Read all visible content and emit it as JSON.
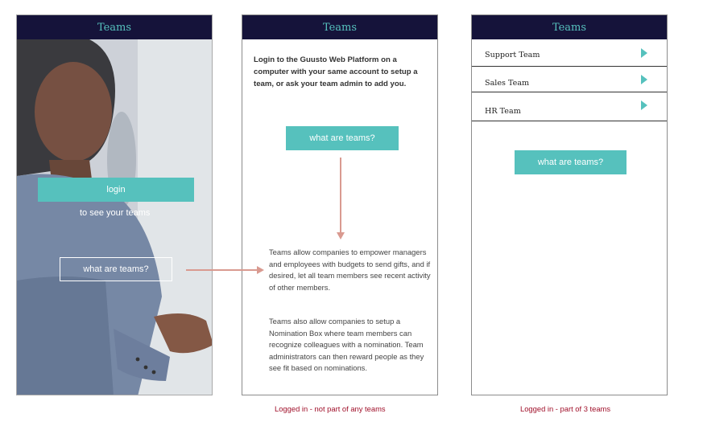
{
  "screens": {
    "logged_out": {
      "title": "Teams",
      "login_label": "login",
      "subtext": "to see your teams",
      "what_are_teams_label": "what are teams?"
    },
    "no_teams": {
      "title": "Teams",
      "message": "Login to the Guusto Web Platform on a computer with your same account to setup a team, or ask your team admin to add you.",
      "what_are_teams_label": "what are teams?",
      "explanation_1": "Teams allow companies to empower managers and employees with budgets to send gifts, and if desired, let all team members see recent activity of other members.",
      "explanation_2": "Teams also allow companies to setup a Nomination Box where team members can recognize colleagues with a nomination. Team administrators can then reward people as they see fit based on nominations."
    },
    "with_teams": {
      "title": "Teams",
      "teams": [
        {
          "label": "Support Team"
        },
        {
          "label": "Sales Team"
        },
        {
          "label": "HR Team"
        }
      ],
      "what_are_teams_label": "what are teams?"
    }
  },
  "captions": {
    "no_teams": "Logged in - not part of any teams",
    "with_teams": "Logged in - part of 3 teams"
  },
  "colors": {
    "header_bg": "#15133a",
    "accent_teal": "#56c1bd",
    "caption_red": "#a0102a",
    "flow_arrow": "#d99a90"
  }
}
